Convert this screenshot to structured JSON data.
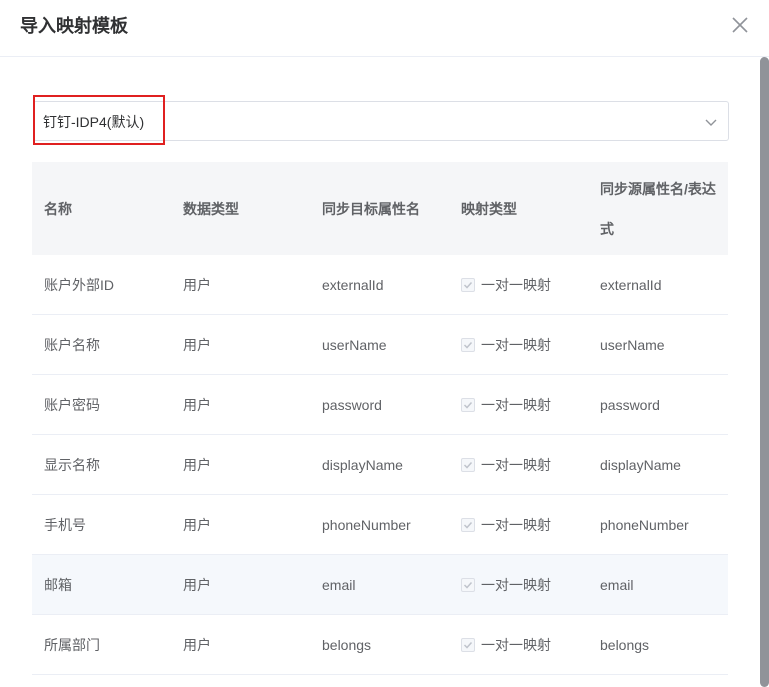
{
  "dialog": {
    "title": "导入映射模板"
  },
  "template_select": {
    "value": "钉钉-IDP4(默认)"
  },
  "table": {
    "headers": {
      "name": "名称",
      "data_type": "数据类型",
      "target_attr": "同步目标属性名",
      "mapping_type": "映射类型",
      "source_attr": "同步源属性名/表达式"
    },
    "rows": [
      {
        "name": "账户外部ID",
        "data_type": "用户",
        "target_attr": "externalId",
        "mapping_type": "一对一映射",
        "source_attr": "externalId"
      },
      {
        "name": "账户名称",
        "data_type": "用户",
        "target_attr": "userName",
        "mapping_type": "一对一映射",
        "source_attr": "userName"
      },
      {
        "name": "账户密码",
        "data_type": "用户",
        "target_attr": "password",
        "mapping_type": "一对一映射",
        "source_attr": "password"
      },
      {
        "name": "显示名称",
        "data_type": "用户",
        "target_attr": "displayName",
        "mapping_type": "一对一映射",
        "source_attr": "displayName"
      },
      {
        "name": "手机号",
        "data_type": "用户",
        "target_attr": "phoneNumber",
        "mapping_type": "一对一映射",
        "source_attr": "phoneNumber"
      },
      {
        "name": "邮箱",
        "data_type": "用户",
        "target_attr": "email",
        "mapping_type": "一对一映射",
        "source_attr": "email"
      },
      {
        "name": "所属部门",
        "data_type": "用户",
        "target_attr": "belongs",
        "mapping_type": "一对一映射",
        "source_attr": "belongs"
      }
    ]
  },
  "colors": {
    "highlight": "#e02020",
    "header_bg": "#f5f6f8",
    "hover_row_bg": "#f5f8fc"
  },
  "icons": {
    "close": "close-icon",
    "dropdown": "chevron-down-icon",
    "checkbox": "check-icon"
  }
}
